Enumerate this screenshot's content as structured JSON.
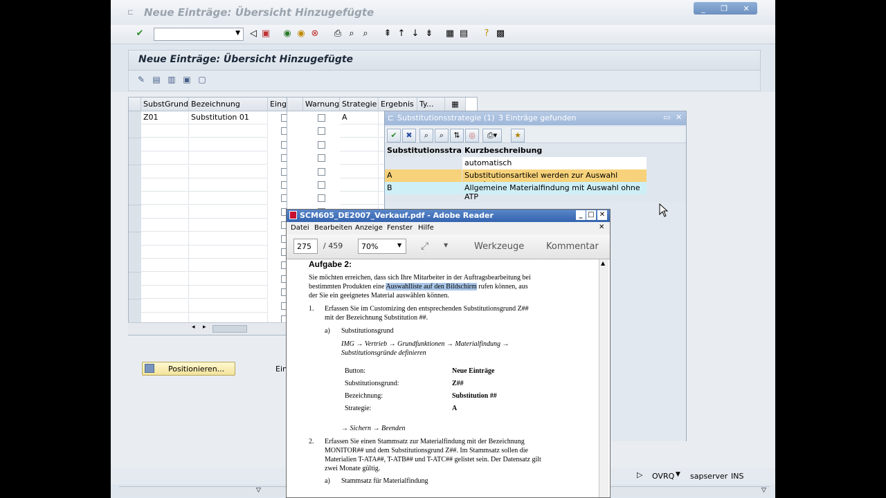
{
  "sap": {
    "window_title": "Neue Einträge: Übersicht Hinzugefügte",
    "header_title": "Neue Einträge: Übersicht Hinzugefügte",
    "win_buttons": [
      "_",
      "❐",
      "✕"
    ],
    "grid": {
      "columns": [
        "SubstGrund",
        "Bezeichnung",
        "Eingabe",
        "Warnung",
        "Strategie",
        "Ergebnis",
        "Ty..."
      ],
      "rows": [
        {
          "grund": "Z01",
          "bezeichnung": "Substitution 01",
          "strategie": "A"
        }
      ]
    },
    "position_button": "Positionieren...",
    "ein_label": "Ein",
    "status": {
      "system": "OVRQ",
      "server": "sapserver",
      "mode": "INS"
    }
  },
  "popup": {
    "title": "Substitutionsstrategie (1)",
    "found": "3 Einträge gefunden",
    "columns": [
      "Substitutionsstra...",
      "Kurzbeschreibung"
    ],
    "rows": [
      {
        "key": "",
        "desc": "automatisch"
      },
      {
        "key": "A",
        "desc": "Substitutionsartikel werden zur Auswahl angeboten"
      },
      {
        "key": "B",
        "desc": "Allgemeine Materialfindung mit Auswahl ohne ATP"
      }
    ]
  },
  "adobe": {
    "title": "SCM605_DE2007_Verkauf.pdf - Adobe Reader",
    "menu": [
      "Datei",
      "Bearbeiten",
      "Anzeige",
      "Fenster",
      "Hilfe"
    ],
    "page": "275",
    "page_total": "/ 459",
    "zoom": "70%",
    "tools": "Werkzeuge",
    "comment": "Kommentar",
    "doc": {
      "heading": "Aufgabe 2:",
      "intro1": "Sie möchten erreichen, dass sich Ihre Mitarbeiter in der Auftragsbearbeitung bei",
      "intro2a": "bestimmten Produkten eine ",
      "intro2hl": "Auswahlliste auf den Bildschirm",
      "intro2b": " rufen können, aus",
      "intro3": "der Sie ein geeignetes Material auswählen können.",
      "s1num": "1.",
      "s1a": "Erfassen Sie im Customizing den entsprechenden Substitutionsgrund Z##",
      "s1b": "mit der Bezeichnung Substitution ##.",
      "s1sub": "a)",
      "s1subtext": "Substitutionsgrund",
      "path1": "IMG → Vertrieb → Grundfunktionen → Materialfindung →",
      "path2": "Substitutionsgründe definieren",
      "kv": [
        {
          "k": "Button:",
          "v": "Neue Einträge"
        },
        {
          "k": "Substitutionsgrund:",
          "v": "Z##"
        },
        {
          "k": "Bezeichnung:",
          "v": "Substitution ##"
        },
        {
          "k": "Strategie:",
          "v": "A"
        }
      ],
      "save": "→ Sichern → Beenden",
      "s2num": "2.",
      "s2a": "Erfassen Sie einen Stammsatz zur Materialfindung mit der Bezeichnung",
      "s2b": "MONITOR## und dem Substitutionsgrund Z##. Im Stammsatz sollen die",
      "s2c": "Materialien T-ATA##, T-ATB## und T-ATC## gelistet sein. Der Datensatz gilt",
      "s2d": "zwei Monate gültig.",
      "s2sub": "a)",
      "s2subtext": "Stammsatz für Materialfindung"
    }
  }
}
